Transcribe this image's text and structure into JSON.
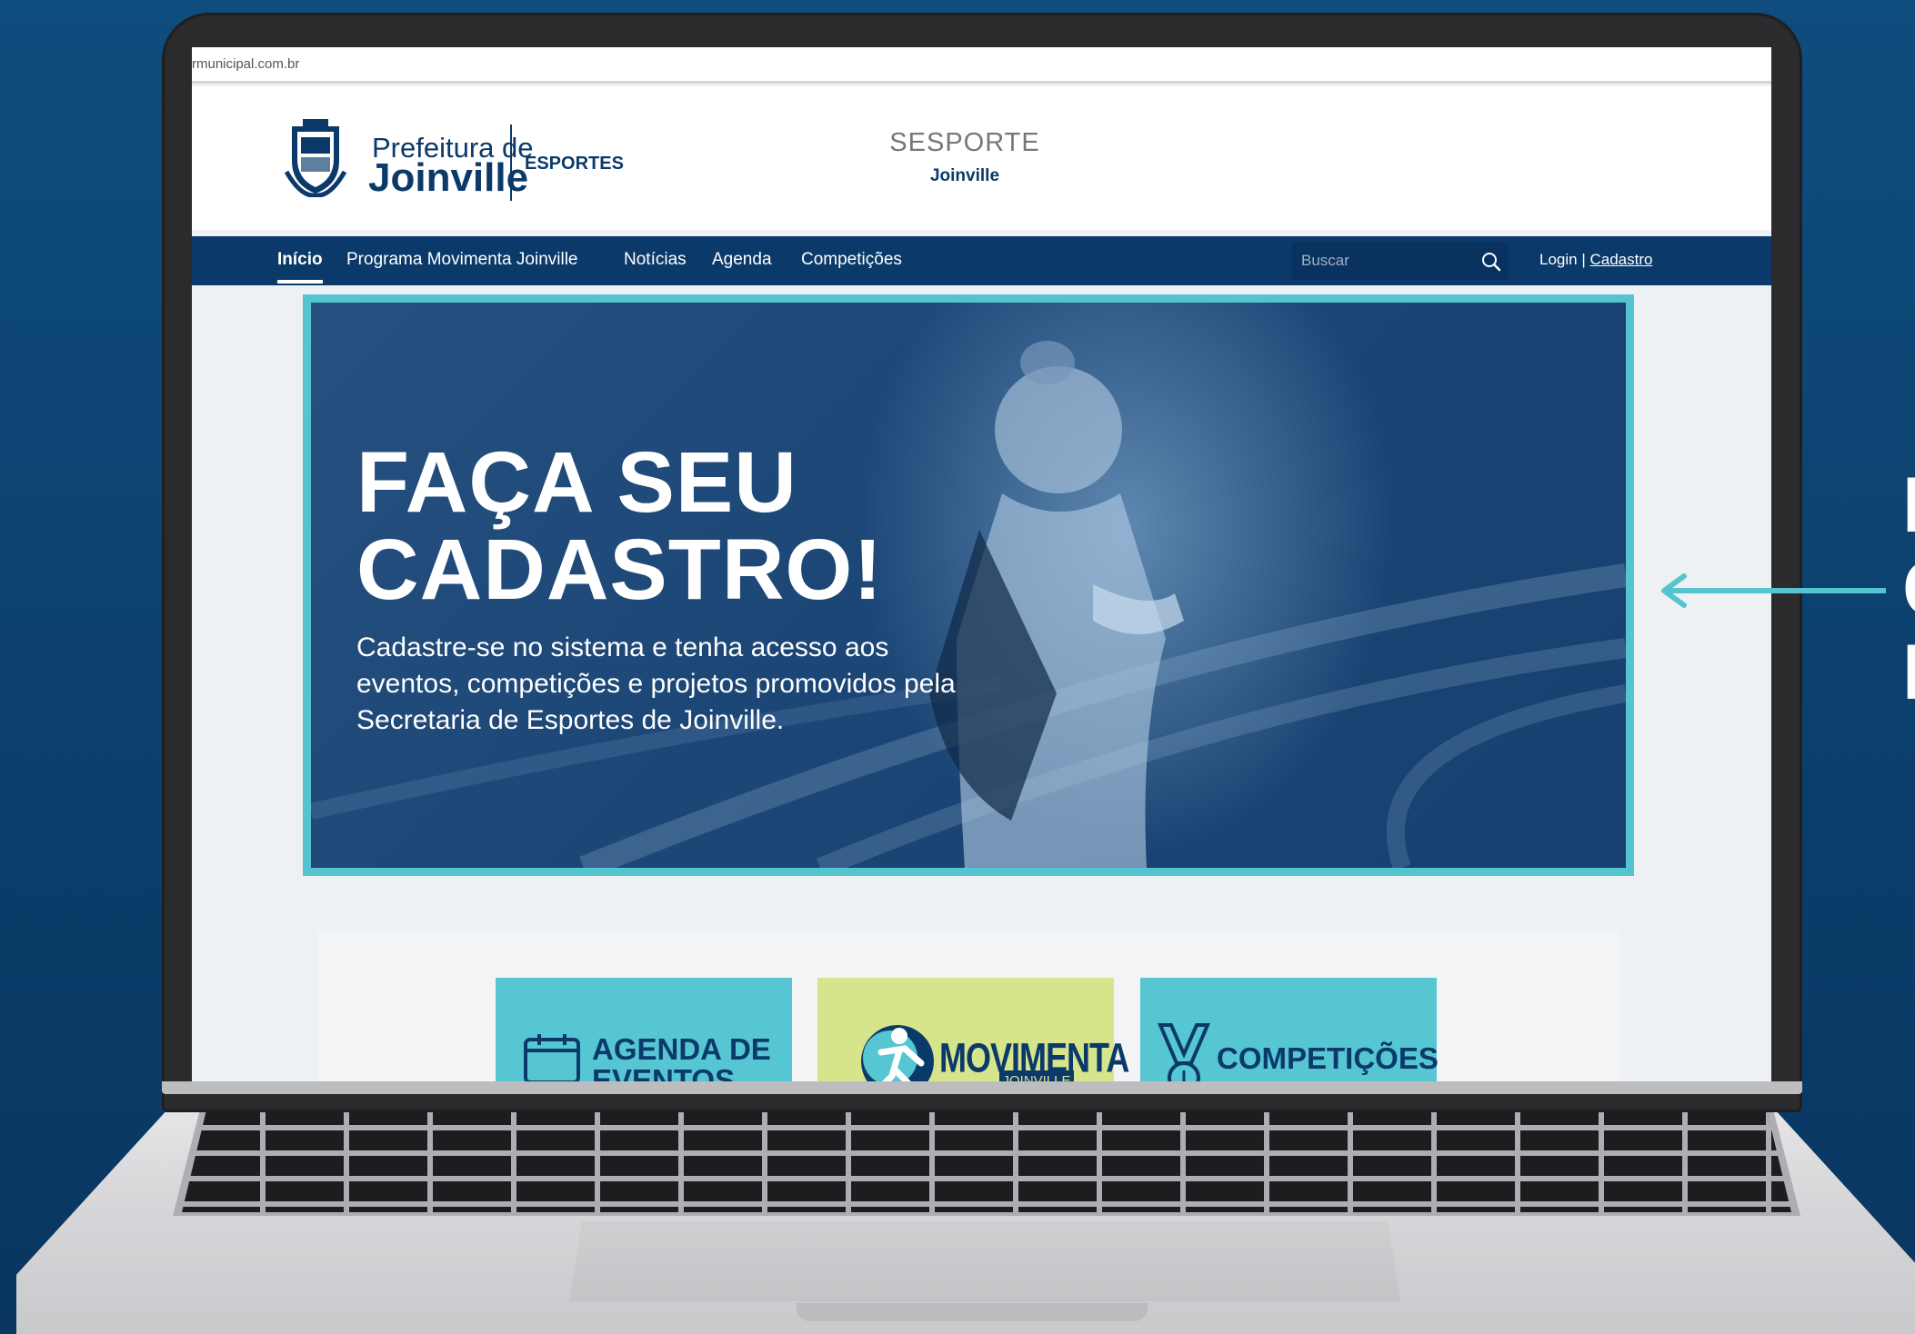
{
  "browser": {
    "url": "rmunicipal.com.br"
  },
  "header": {
    "brand_line1": "Prefeitura de",
    "brand_line2": "Joinville",
    "brand_sub": "ESPORTES",
    "site_title": "SESPORTE",
    "site_subtitle": "Joinville"
  },
  "nav": {
    "items": [
      "Início",
      "Programa Movimenta Joinville",
      "Notícias",
      "Agenda",
      "Competições"
    ],
    "active_index": 0,
    "search_placeholder": "Buscar",
    "login_label": "Login",
    "separator": "|",
    "signup_label": "Cadastro"
  },
  "hero": {
    "title": "FAÇA SEU\nCADASTRO!",
    "text": "Cadastre-se no sistema e tenha acesso aos eventos, competições e projetos promovidos pela Secretaria de Esportes de Joinville."
  },
  "tiles": {
    "agenda": "AGENDA DE\nEVENTOS",
    "movimenta_word": "MOVIMENTA",
    "movimenta_sub": "JOINVILLE",
    "competicoes": "COMPETIÇÕES"
  },
  "annotation": {
    "letters": "I\nC\nI"
  },
  "colors": {
    "background": "#0b3f6c",
    "navy": "#0b3a6a",
    "accent_teal": "#55c4d1",
    "accent_lime": "#d6e48c"
  },
  "icons": [
    "crest-icon",
    "search-icon",
    "calendar-icon",
    "runner-icon",
    "medal-icon",
    "arrow-left-icon"
  ]
}
